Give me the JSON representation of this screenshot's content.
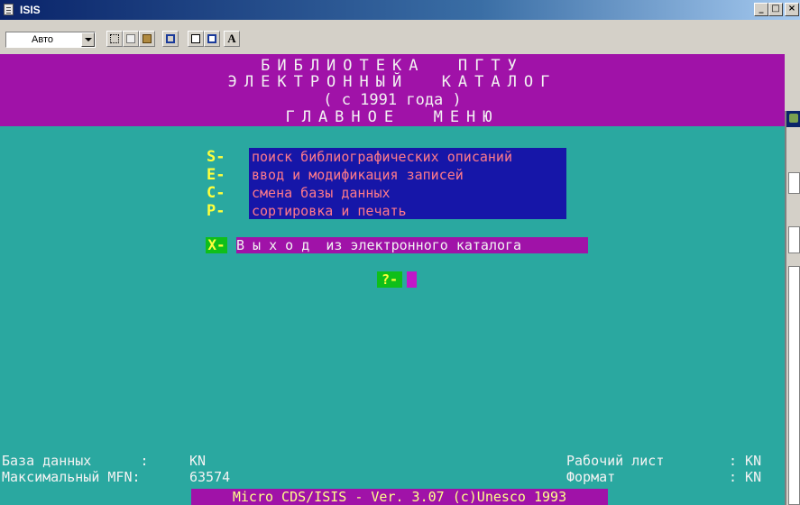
{
  "window": {
    "title": "ISIS",
    "controls": [
      "_",
      "□",
      "×"
    ]
  },
  "toolbar": {
    "font_select": "Авто",
    "icons": [
      "select-icon",
      "copy-icon",
      "paste-icon",
      "fullscreen-icon",
      "properties-icon",
      "background-icon",
      "font-icon"
    ],
    "font_icon_label": "A"
  },
  "header": {
    "line1": "БИБЛИОТЕКА  ПГТУ",
    "line2": "ЭЛЕКТРОННЫЙ  КАТАЛОГ",
    "line3": "( с 1991 года )",
    "line4": "ГЛАВНОЕ  МЕНЮ"
  },
  "menu": {
    "items": [
      {
        "key": "S-",
        "label": "поиск библиографических описаний"
      },
      {
        "key": "E-",
        "label": "ввод и модификация записей"
      },
      {
        "key": "C-",
        "label": "смена базы данных"
      },
      {
        "key": "P-",
        "label": "сортировка и печать"
      }
    ],
    "exit": {
      "key": "X-",
      "label": "В ы х о д  из электронного каталога"
    },
    "prompt": "?-"
  },
  "status": {
    "db_label": "База данных      :",
    "db_value": "KN",
    "mfn_label": "Максимальный MFN:",
    "mfn_value": "63574",
    "worksheet_label": "Рабочий лист",
    "worksheet_value": ": KN",
    "format_label": "Формат",
    "format_value": ": KN"
  },
  "footer": "Micro CDS/ISIS - Ver. 3.07 (c)Unesco 1993",
  "colors": {
    "terminal_bg": "#2aa8a0",
    "header_bg": "#a012a8",
    "menu_bg": "#1616a8",
    "key_fg": "#ffff3c",
    "menu_text": "#ff7a8a",
    "prompt_bg": "#0fbf1a"
  }
}
